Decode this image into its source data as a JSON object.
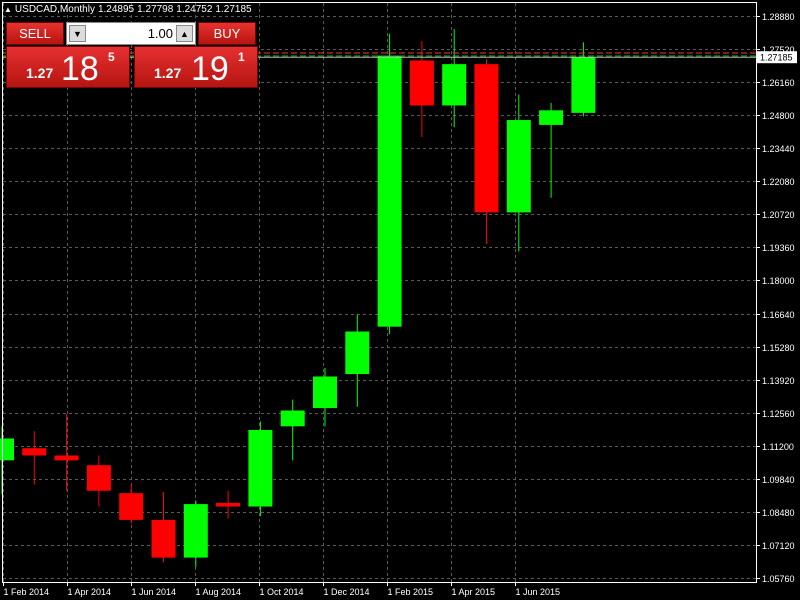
{
  "header": {
    "title": "USDCAD,Monthly",
    "open": "1.24895",
    "high": "1.27798",
    "low": "1.24752",
    "close": "1.27185"
  },
  "trade_panel": {
    "sell_label": "SELL",
    "buy_label": "BUY",
    "lot_value": "1.00",
    "sell_price": {
      "small": "1.27",
      "big": "18",
      "sup": "5"
    },
    "buy_price": {
      "small": "1.27",
      "big": "19",
      "sup": "1"
    }
  },
  "colors": {
    "background": "#000000",
    "bull": "#00ff00",
    "bear": "#ff0000",
    "grid": "#5a5a5a",
    "axis_text": "#ffffff",
    "price_label_bg": "#ffffff",
    "panel_red": "#cc1f1a"
  },
  "chart_data": {
    "type": "candlestick",
    "symbol": "USDCAD",
    "timeframe": "Monthly",
    "current_price": 1.27185,
    "ask_line": 1.27191,
    "y_ticks": [
      "1.28880",
      "1.27520",
      "1.26160",
      "1.24800",
      "1.23440",
      "1.22080",
      "1.20720",
      "1.19360",
      "1.18000",
      "1.16640",
      "1.15280",
      "1.13920",
      "1.12560",
      "1.11200",
      "1.09840",
      "1.08480",
      "1.07120",
      "1.05760"
    ],
    "ylim": [
      1.0576,
      1.2888
    ],
    "x_labels": [
      "1 Feb 2014",
      "1 Apr 2014",
      "1 Jun 2014",
      "1 Aug 2014",
      "1 Oct 2014",
      "1 Dec 2014",
      "1 Feb 2015",
      "1 Apr 2015",
      "1 Jun 2015"
    ],
    "candles": [
      {
        "date": "2013-11",
        "open": 1.106,
        "high": 1.12,
        "low": 1.092,
        "close": 1.115
      },
      {
        "date": "2013-12",
        "open": 1.111,
        "high": 1.118,
        "low": 1.096,
        "close": 1.108
      },
      {
        "date": "2014-01",
        "open": 1.108,
        "high": 1.125,
        "low": 1.0935,
        "close": 1.106
      },
      {
        "date": "2014-02",
        "open": 1.104,
        "high": 1.108,
        "low": 1.087,
        "close": 1.0935
      },
      {
        "date": "2014-03",
        "open": 1.0925,
        "high": 1.096,
        "low": 1.08,
        "close": 1.0815
      },
      {
        "date": "2014-04",
        "open": 1.0815,
        "high": 1.093,
        "low": 1.064,
        "close": 1.066
      },
      {
        "date": "2014-05",
        "open": 1.066,
        "high": 1.0895,
        "low": 1.062,
        "close": 1.088
      },
      {
        "date": "2014-06",
        "open": 1.0885,
        "high": 1.0935,
        "low": 1.082,
        "close": 1.087
      },
      {
        "date": "2014-07",
        "open": 1.087,
        "high": 1.122,
        "low": 1.083,
        "close": 1.1185
      },
      {
        "date": "2014-08",
        "open": 1.12,
        "high": 1.131,
        "low": 1.106,
        "close": 1.1265
      },
      {
        "date": "2014-09",
        "open": 1.1275,
        "high": 1.144,
        "low": 1.12,
        "close": 1.1405
      },
      {
        "date": "2014-10",
        "open": 1.1415,
        "high": 1.166,
        "low": 1.128,
        "close": 1.159
      },
      {
        "date": "2014-11",
        "open": 1.161,
        "high": 1.2815,
        "low": 1.158,
        "close": 1.2725
      },
      {
        "date": "2014-12",
        "open": 1.2705,
        "high": 1.2785,
        "low": 1.239,
        "close": 1.252
      },
      {
        "date": "2015-01",
        "open": 1.252,
        "high": 1.2835,
        "low": 1.243,
        "close": 1.269
      },
      {
        "date": "2015-02",
        "open": 1.269,
        "high": 1.271,
        "low": 1.195,
        "close": 1.208
      },
      {
        "date": "2015-03",
        "open": 1.208,
        "high": 1.2565,
        "low": 1.192,
        "close": 1.246
      },
      {
        "date": "2015-04",
        "open": 1.244,
        "high": 1.253,
        "low": 1.214,
        "close": 1.25
      },
      {
        "date": "2015-05",
        "open": 1.24895,
        "high": 1.27798,
        "low": 1.24752,
        "close": 1.27185
      }
    ]
  }
}
